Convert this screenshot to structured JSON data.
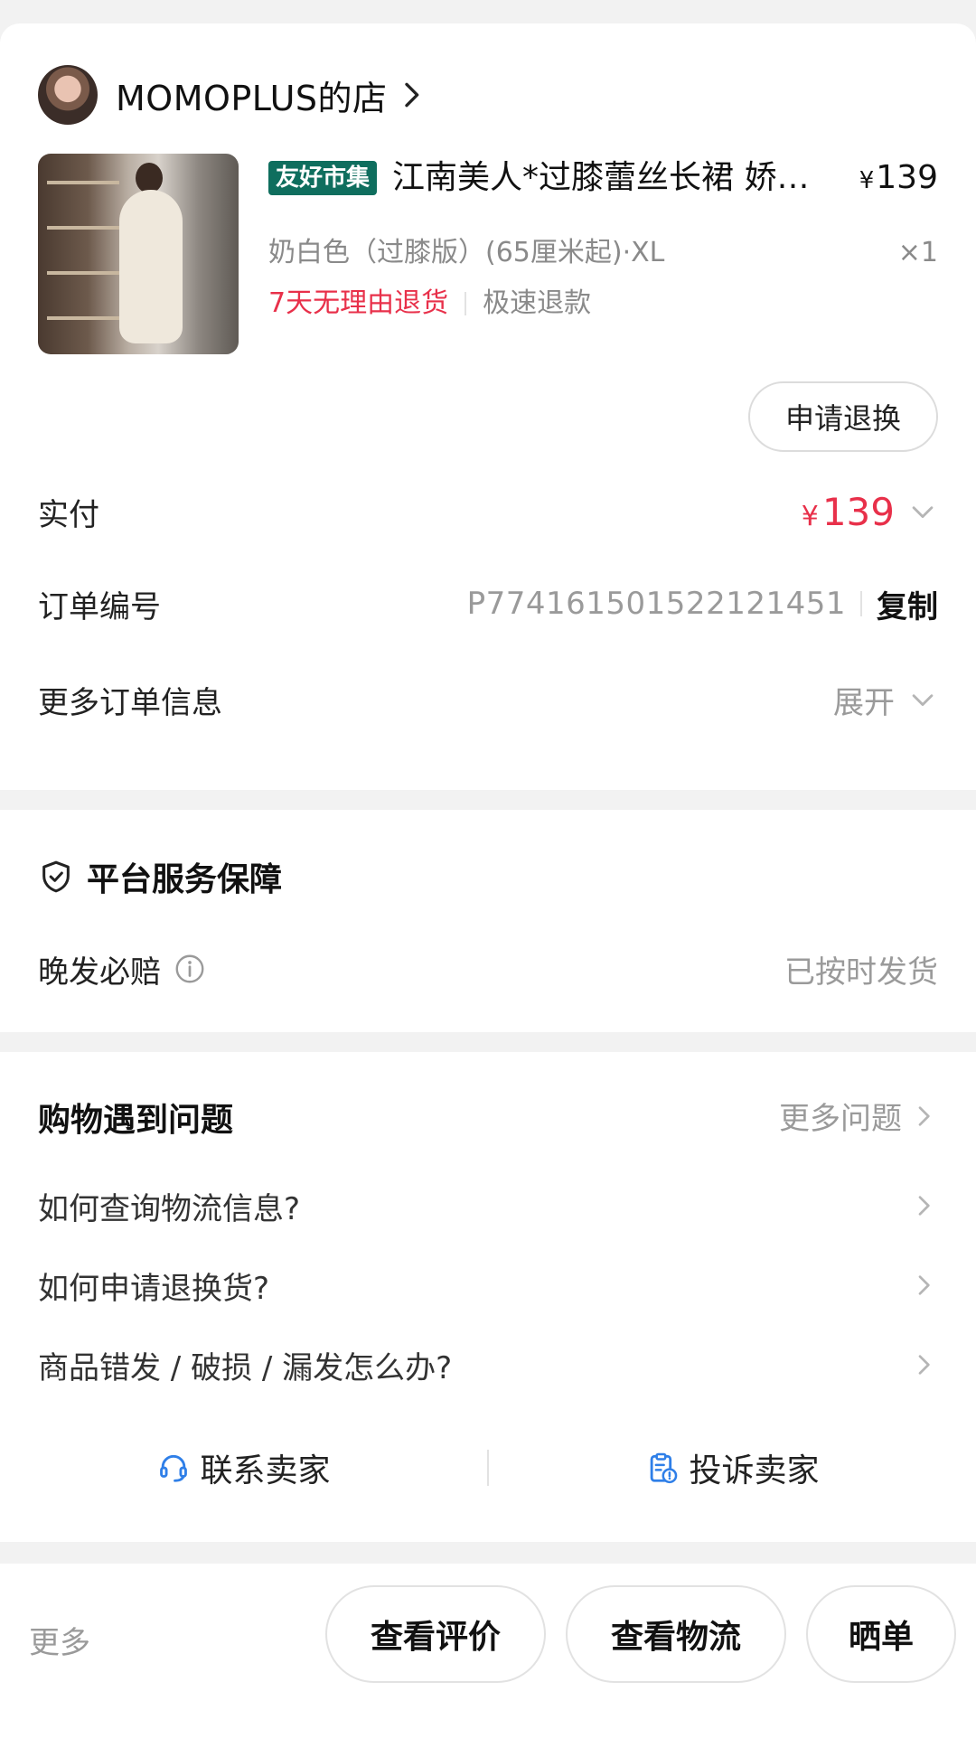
{
  "shop": {
    "name": "MOMOPLUS的店"
  },
  "product": {
    "tag": "友好市集",
    "title": "江南美人*过膝蕾丝长裙 娇…",
    "price_symbol": "¥",
    "price": "139",
    "spec": "奶白色（过膝版）(65厘米起)·XL",
    "quantity": "×1",
    "service_tag_1": "7天无理由退货",
    "service_tag_2": "极速退款"
  },
  "actions": {
    "return_exchange": "申请退换"
  },
  "order_info": {
    "paid_label": "实付",
    "paid_symbol": "¥",
    "paid_amount": "139",
    "order_no_label": "订单编号",
    "order_no": "P774161501522121451",
    "copy_label": "复制",
    "more_info_label": "更多订单信息",
    "expand_label": "展开"
  },
  "guarantee": {
    "title": "平台服务保障",
    "late_ship_label": "晚发必赔",
    "late_ship_status": "已按时发货"
  },
  "help": {
    "title": "购物遇到问题",
    "more_questions": "更多问题",
    "faqs": [
      "如何查询物流信息?",
      "如何申请退换货?",
      "商品错发 / 破损 / 漏发怎么办?"
    ],
    "contact_seller": "联系卖家",
    "complain_seller": "投诉卖家"
  },
  "bottom_bar": {
    "more": "更多",
    "view_review": "查看评价",
    "view_logistics": "查看物流",
    "share_order": "晒单"
  },
  "colors": {
    "accent_red": "#e8304a",
    "tag_green": "#0f6e5e",
    "muted_gray": "#9a9a9a",
    "link_blue": "#2f7fe8"
  }
}
